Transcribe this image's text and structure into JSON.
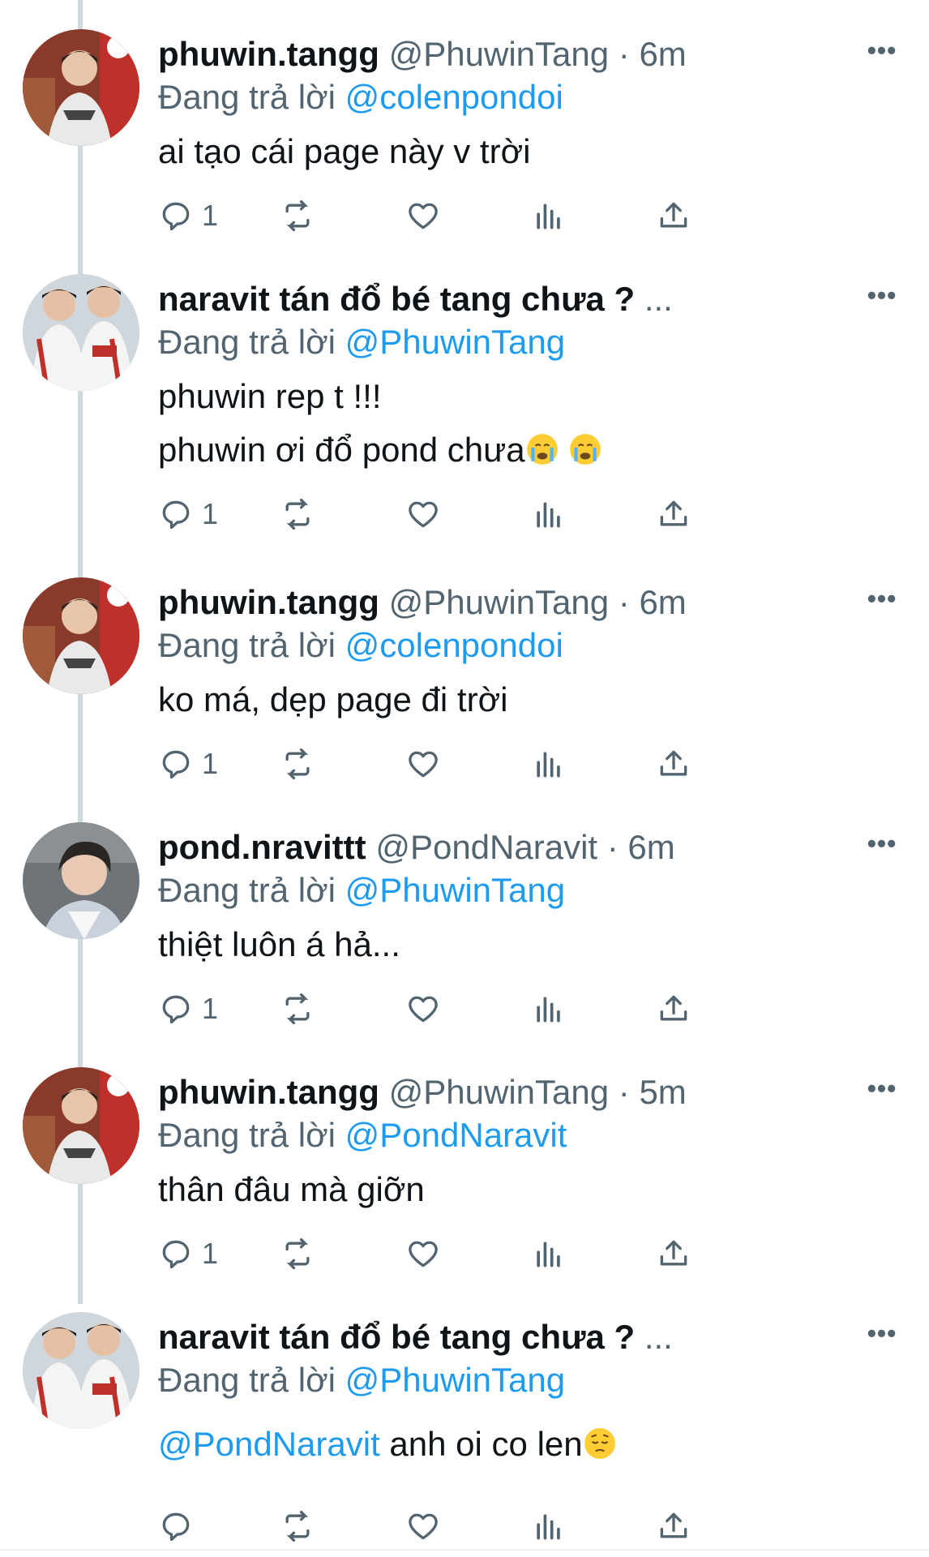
{
  "colors": {
    "link": "#1d9bf0",
    "muted": "#536471",
    "text": "#0f1419",
    "thread_line": "#cfd9de"
  },
  "tweets": [
    {
      "name": "phuwin.tangg",
      "handle": "@PhuwinTang",
      "dot": "·",
      "time": "6m",
      "reply_prefix": "Đang trả lời",
      "reply_to": "@colenpondoi",
      "line1": "ai tạo cái page này v trời",
      "reply_count": "1"
    },
    {
      "name": "naravit tán đổ bé tang chưa ?",
      "name_more": "...",
      "reply_prefix": "Đang trả lời",
      "reply_to": "@PhuwinTang",
      "line1": "phuwin rep t !!!",
      "line2": "phuwin ơi đổ pond chưa",
      "emoji": "crying-face",
      "reply_count": "1"
    },
    {
      "name": "phuwin.tangg",
      "handle": "@PhuwinTang",
      "dot": "·",
      "time": "6m",
      "reply_prefix": "Đang trả lời",
      "reply_to": "@colenpondoi",
      "line1": "ko má, dẹp page đi trời",
      "reply_count": "1"
    },
    {
      "name": "pond.nravittt",
      "handle": "@PondNaravit",
      "dot": "·",
      "time": "6m",
      "reply_prefix": "Đang trả lời",
      "reply_to": "@PhuwinTang",
      "line1": "thiệt luôn á hả...",
      "reply_count": "1"
    },
    {
      "name": "phuwin.tangg",
      "handle": "@PhuwinTang",
      "dot": "·",
      "time": "5m",
      "reply_prefix": "Đang trả lời",
      "reply_to": "@PondNaravit",
      "line1": "thân đâu mà giỡn",
      "reply_count": "1"
    },
    {
      "name": "naravit tán đổ bé tang chưa ?",
      "name_more": "...",
      "reply_prefix": "Đang trả lời",
      "reply_to": "@PhuwinTang",
      "mention": "@PondNaravit",
      "line1": " anh oi co len",
      "emoji": "pensive-face",
      "reply_count": ""
    }
  ]
}
